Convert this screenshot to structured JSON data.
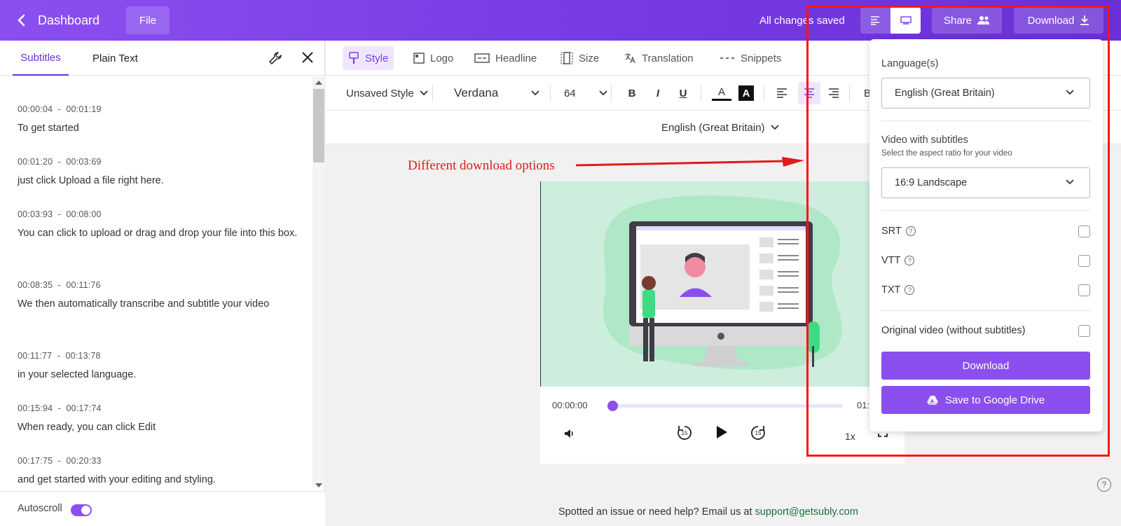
{
  "topbar": {
    "back_label": "Dashboard",
    "file_label": "File",
    "status": "All changes saved",
    "share_label": "Share",
    "download_label": "Download"
  },
  "left_panel": {
    "tabs": [
      "Subtitles",
      "Plain Text"
    ],
    "subtitles": [
      {
        "start": "00:00:04",
        "end": "00:01:19",
        "text": "To get started"
      },
      {
        "start": "00:01:20",
        "end": "00:03:69",
        "text": "just click Upload a file right here."
      },
      {
        "start": "00:03:93",
        "end": "00:08:00",
        "text": "You can click to upload or drag and drop your file into this box."
      },
      {
        "start": "00:08:35",
        "end": "00:11:76",
        "text": "We then automatically transcribe and subtitle your video"
      },
      {
        "start": "00:11:77",
        "end": "00:13:78",
        "text": "in your selected language."
      },
      {
        "start": "00:15:94",
        "end": "00:17:74",
        "text": "When ready, you can click Edit"
      },
      {
        "start": "00:17:75",
        "end": "00:20:33",
        "text": "and get started with your editing and styling."
      }
    ],
    "time_separator": "-",
    "autoscroll_label": "Autoscroll"
  },
  "toolbar": {
    "tools": [
      "Style",
      "Logo",
      "Headline",
      "Size",
      "Translation",
      "Snippets"
    ],
    "style_preset": "Unsaved Style",
    "font": "Verdana",
    "font_size": "64",
    "bold": "B",
    "italic": "I",
    "underline": "U",
    "text_color": "A",
    "bg_color": "A",
    "more": "B"
  },
  "language_bar": {
    "selected": "English (Great Britain)"
  },
  "annotation": "Different download options",
  "player": {
    "current_time": "00:00:00",
    "end_time": "01:",
    "progress": 0,
    "speed": "1x",
    "skip_back": "15",
    "skip_forward": "15"
  },
  "footer": {
    "help_text": "Spotted an issue or need help? Email us at ",
    "email": "support@getsubly.com",
    "help_icon": "?"
  },
  "download_panel": {
    "languages_label": "Language(s)",
    "language_value": "English (Great Britain)",
    "video_label": "Video with subtitles",
    "video_hint": "Select the aspect ratio for your video",
    "aspect_value": "16:9 Landscape",
    "formats": [
      {
        "label": "SRT",
        "checked": false
      },
      {
        "label": "VTT",
        "checked": false
      },
      {
        "label": "TXT",
        "checked": false
      }
    ],
    "original_label": "Original video (without subtitles)",
    "download_button": "Download",
    "drive_button": "Save to Google Drive"
  },
  "colors": {
    "brand": "#8b4ff0",
    "annotation": "#e01b1b",
    "highlight_box": "#ff1414"
  }
}
